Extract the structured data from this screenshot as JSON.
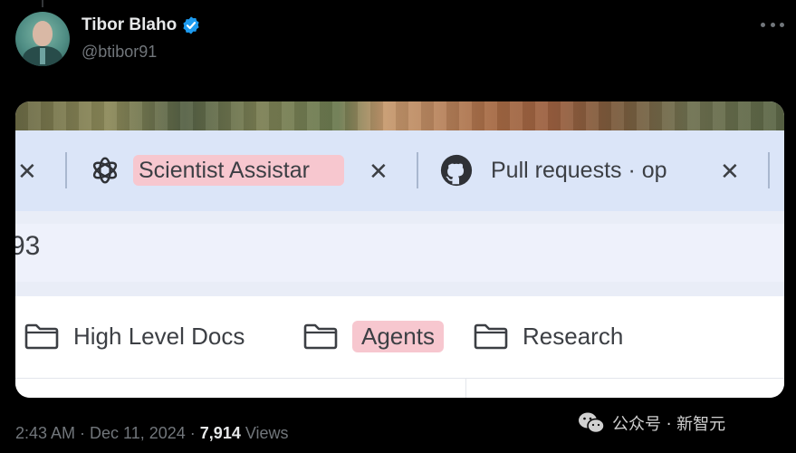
{
  "author": {
    "name": "Tibor Blaho",
    "handle": "@btibor91",
    "verified": true,
    "verified_color": "#1d9bf0"
  },
  "screenshot": {
    "tabs": [
      {
        "title": "Scientist Assistar",
        "icon": "openai-logo-icon",
        "highlighted": true
      },
      {
        "title": "Pull requests · op",
        "icon": "github-logo-icon",
        "highlighted": false
      }
    ],
    "address_fragment": "93",
    "bookmarks": [
      {
        "label": "High Level Docs",
        "icon": "folder-icon",
        "highlighted": false
      },
      {
        "label": "Agents",
        "icon": "folder-icon",
        "highlighted": true
      },
      {
        "label": "Research",
        "icon": "folder-icon",
        "highlighted": false
      }
    ],
    "highlight_color": "#f7c7cf",
    "tabbar_color": "#dbe5f8"
  },
  "post_meta": {
    "time": "2:43 AM",
    "separator": " · ",
    "date": "Dec 11, 2024",
    "views_count": "7,914",
    "views_label": "Views"
  },
  "watermark": {
    "text": "公众号 · 新智元",
    "icon": "wechat-icon"
  }
}
